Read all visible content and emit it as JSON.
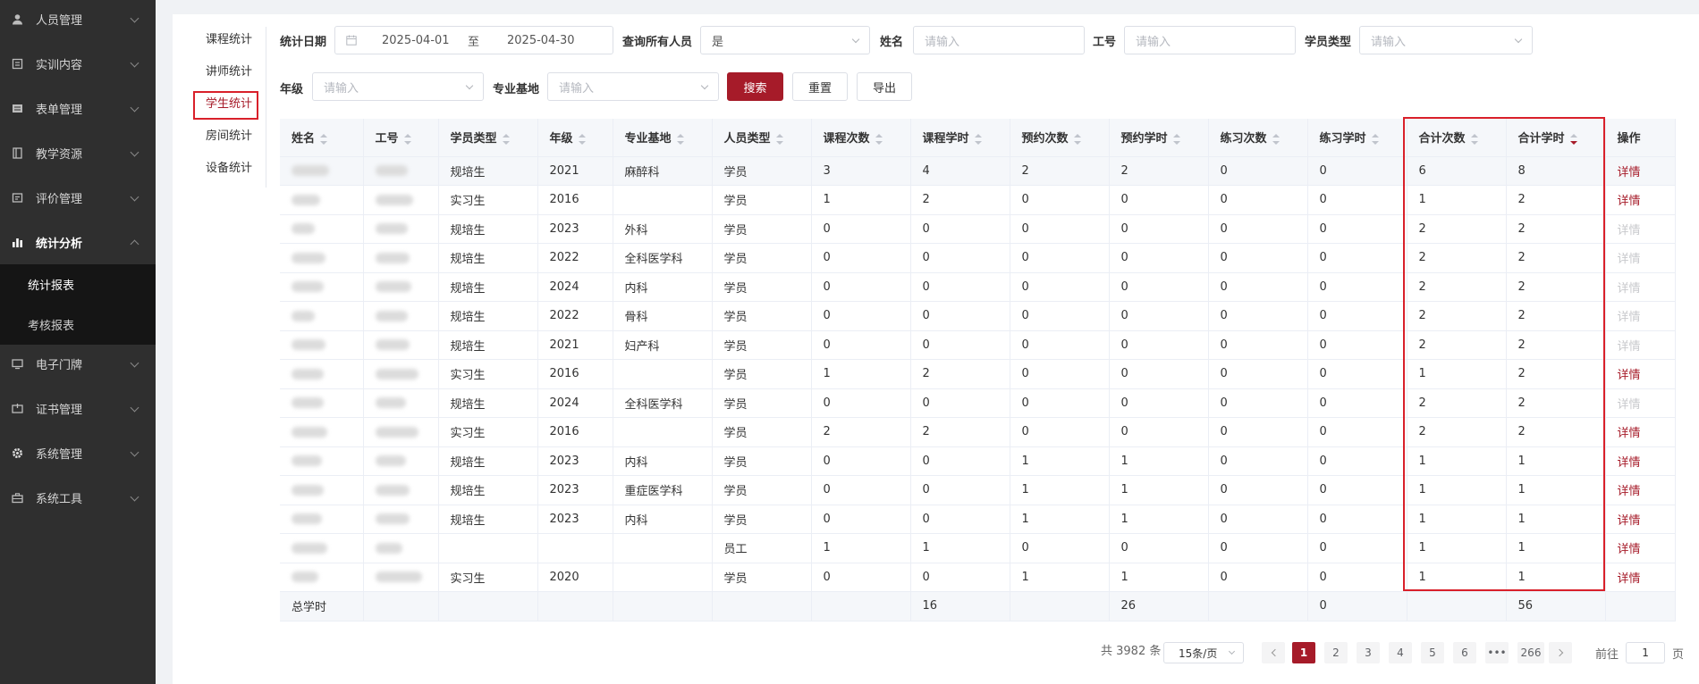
{
  "sidebar": {
    "items": [
      {
        "label": "人员管理",
        "icon": "user-icon"
      },
      {
        "label": "实训内容",
        "icon": "content-icon"
      },
      {
        "label": "表单管理",
        "icon": "form-icon"
      },
      {
        "label": "教学资源",
        "icon": "book-icon"
      },
      {
        "label": "评价管理",
        "icon": "evaluation-icon"
      },
      {
        "label": "统计分析",
        "icon": "bar-chart-icon"
      },
      {
        "label": "电子门牌",
        "icon": "monitor-icon"
      },
      {
        "label": "证书管理",
        "icon": "certificate-icon"
      },
      {
        "label": "系统管理",
        "icon": "gear-icon"
      },
      {
        "label": "系统工具",
        "icon": "toolbox-icon"
      }
    ],
    "sub_items": [
      {
        "label": "统计报表",
        "active": true
      },
      {
        "label": "考核报表",
        "active": false
      }
    ]
  },
  "stat_nav": [
    "课程统计",
    "讲师统计",
    "学生统计",
    "房间统计",
    "设备统计"
  ],
  "filters": {
    "date_label": "统计日期",
    "date_start": "2025-04-01",
    "date_sep": "至",
    "date_end": "2025-04-30",
    "query_all_label": "查询所有人员",
    "query_all_value": "是",
    "name_label": "姓名",
    "name_placeholder": "请输入",
    "id_label": "工号",
    "id_placeholder": "请输入",
    "student_type_label": "学员类型",
    "student_type_placeholder": "请输入",
    "grade_label": "年级",
    "grade_placeholder": "请输入",
    "base_label": "专业基地",
    "base_placeholder": "请输入",
    "search_btn": "搜索",
    "reset_btn": "重置",
    "export_btn": "导出"
  },
  "table": {
    "headers": [
      "姓名",
      "工号",
      "学员类型",
      "年级",
      "专业基地",
      "人员类型",
      "课程次数",
      "课程学时",
      "预约次数",
      "预约学时",
      "练习次数",
      "练习学时",
      "合计次数",
      "合计学时",
      "操作"
    ],
    "action_label": "详情",
    "rows": [
      {
        "type": "规培生",
        "grade": "2021",
        "base": "麻醉科",
        "ptype": "学员",
        "v": [
          "3",
          "4",
          "2",
          "2",
          "0",
          "0",
          "6",
          "8"
        ],
        "link": true
      },
      {
        "type": "实习生",
        "grade": "2016",
        "base": "",
        "ptype": "学员",
        "v": [
          "1",
          "2",
          "0",
          "0",
          "0",
          "0",
          "1",
          "2"
        ],
        "link": true
      },
      {
        "type": "规培生",
        "grade": "2023",
        "base": "外科",
        "ptype": "学员",
        "v": [
          "0",
          "0",
          "0",
          "0",
          "0",
          "0",
          "2",
          "2"
        ],
        "link": false
      },
      {
        "type": "规培生",
        "grade": "2022",
        "base": "全科医学科",
        "ptype": "学员",
        "v": [
          "0",
          "0",
          "0",
          "0",
          "0",
          "0",
          "2",
          "2"
        ],
        "link": false
      },
      {
        "type": "规培生",
        "grade": "2024",
        "base": "内科",
        "ptype": "学员",
        "v": [
          "0",
          "0",
          "0",
          "0",
          "0",
          "0",
          "2",
          "2"
        ],
        "link": false
      },
      {
        "type": "规培生",
        "grade": "2022",
        "base": "骨科",
        "ptype": "学员",
        "v": [
          "0",
          "0",
          "0",
          "0",
          "0",
          "0",
          "2",
          "2"
        ],
        "link": false
      },
      {
        "type": "规培生",
        "grade": "2021",
        "base": "妇产科",
        "ptype": "学员",
        "v": [
          "0",
          "0",
          "0",
          "0",
          "0",
          "0",
          "2",
          "2"
        ],
        "link": false
      },
      {
        "type": "实习生",
        "grade": "2016",
        "base": "",
        "ptype": "学员",
        "v": [
          "1",
          "2",
          "0",
          "0",
          "0",
          "0",
          "1",
          "2"
        ],
        "link": true
      },
      {
        "type": "规培生",
        "grade": "2024",
        "base": "全科医学科",
        "ptype": "学员",
        "v": [
          "0",
          "0",
          "0",
          "0",
          "0",
          "0",
          "2",
          "2"
        ],
        "link": false
      },
      {
        "type": "实习生",
        "grade": "2016",
        "base": "",
        "ptype": "学员",
        "v": [
          "2",
          "2",
          "0",
          "0",
          "0",
          "0",
          "2",
          "2"
        ],
        "link": true
      },
      {
        "type": "规培生",
        "grade": "2023",
        "base": "内科",
        "ptype": "学员",
        "v": [
          "0",
          "0",
          "1",
          "1",
          "0",
          "0",
          "1",
          "1"
        ],
        "link": true
      },
      {
        "type": "规培生",
        "grade": "2023",
        "base": "重症医学科",
        "ptype": "学员",
        "v": [
          "0",
          "0",
          "1",
          "1",
          "0",
          "0",
          "1",
          "1"
        ],
        "link": true
      },
      {
        "type": "规培生",
        "grade": "2023",
        "base": "内科",
        "ptype": "学员",
        "v": [
          "0",
          "0",
          "1",
          "1",
          "0",
          "0",
          "1",
          "1"
        ],
        "link": true
      },
      {
        "type": "",
        "grade": "",
        "base": "",
        "ptype": "员工",
        "v": [
          "1",
          "1",
          "0",
          "0",
          "0",
          "0",
          "1",
          "1"
        ],
        "link": true
      },
      {
        "type": "实习生",
        "grade": "2020",
        "base": "",
        "ptype": "学员",
        "v": [
          "0",
          "0",
          "1",
          "1",
          "0",
          "0",
          "1",
          "1"
        ],
        "link": true
      }
    ],
    "total_label": "总学时",
    "totals": {
      "course_hours": "16",
      "reserve_hours": "26",
      "practice_hours": "0",
      "total_hours": "56"
    }
  },
  "pagination": {
    "total_text": "共 3982 条",
    "page_size": "15条/页",
    "pages": [
      "1",
      "2",
      "3",
      "4",
      "5",
      "6",
      "•••",
      "266"
    ],
    "current": "1",
    "goto_prefix": "前往",
    "goto_value": "1",
    "goto_suffix": "页"
  },
  "colors": {
    "accent": "#a61b29",
    "highlight": "#d9202a",
    "sidebar": "#2f2f2f"
  }
}
